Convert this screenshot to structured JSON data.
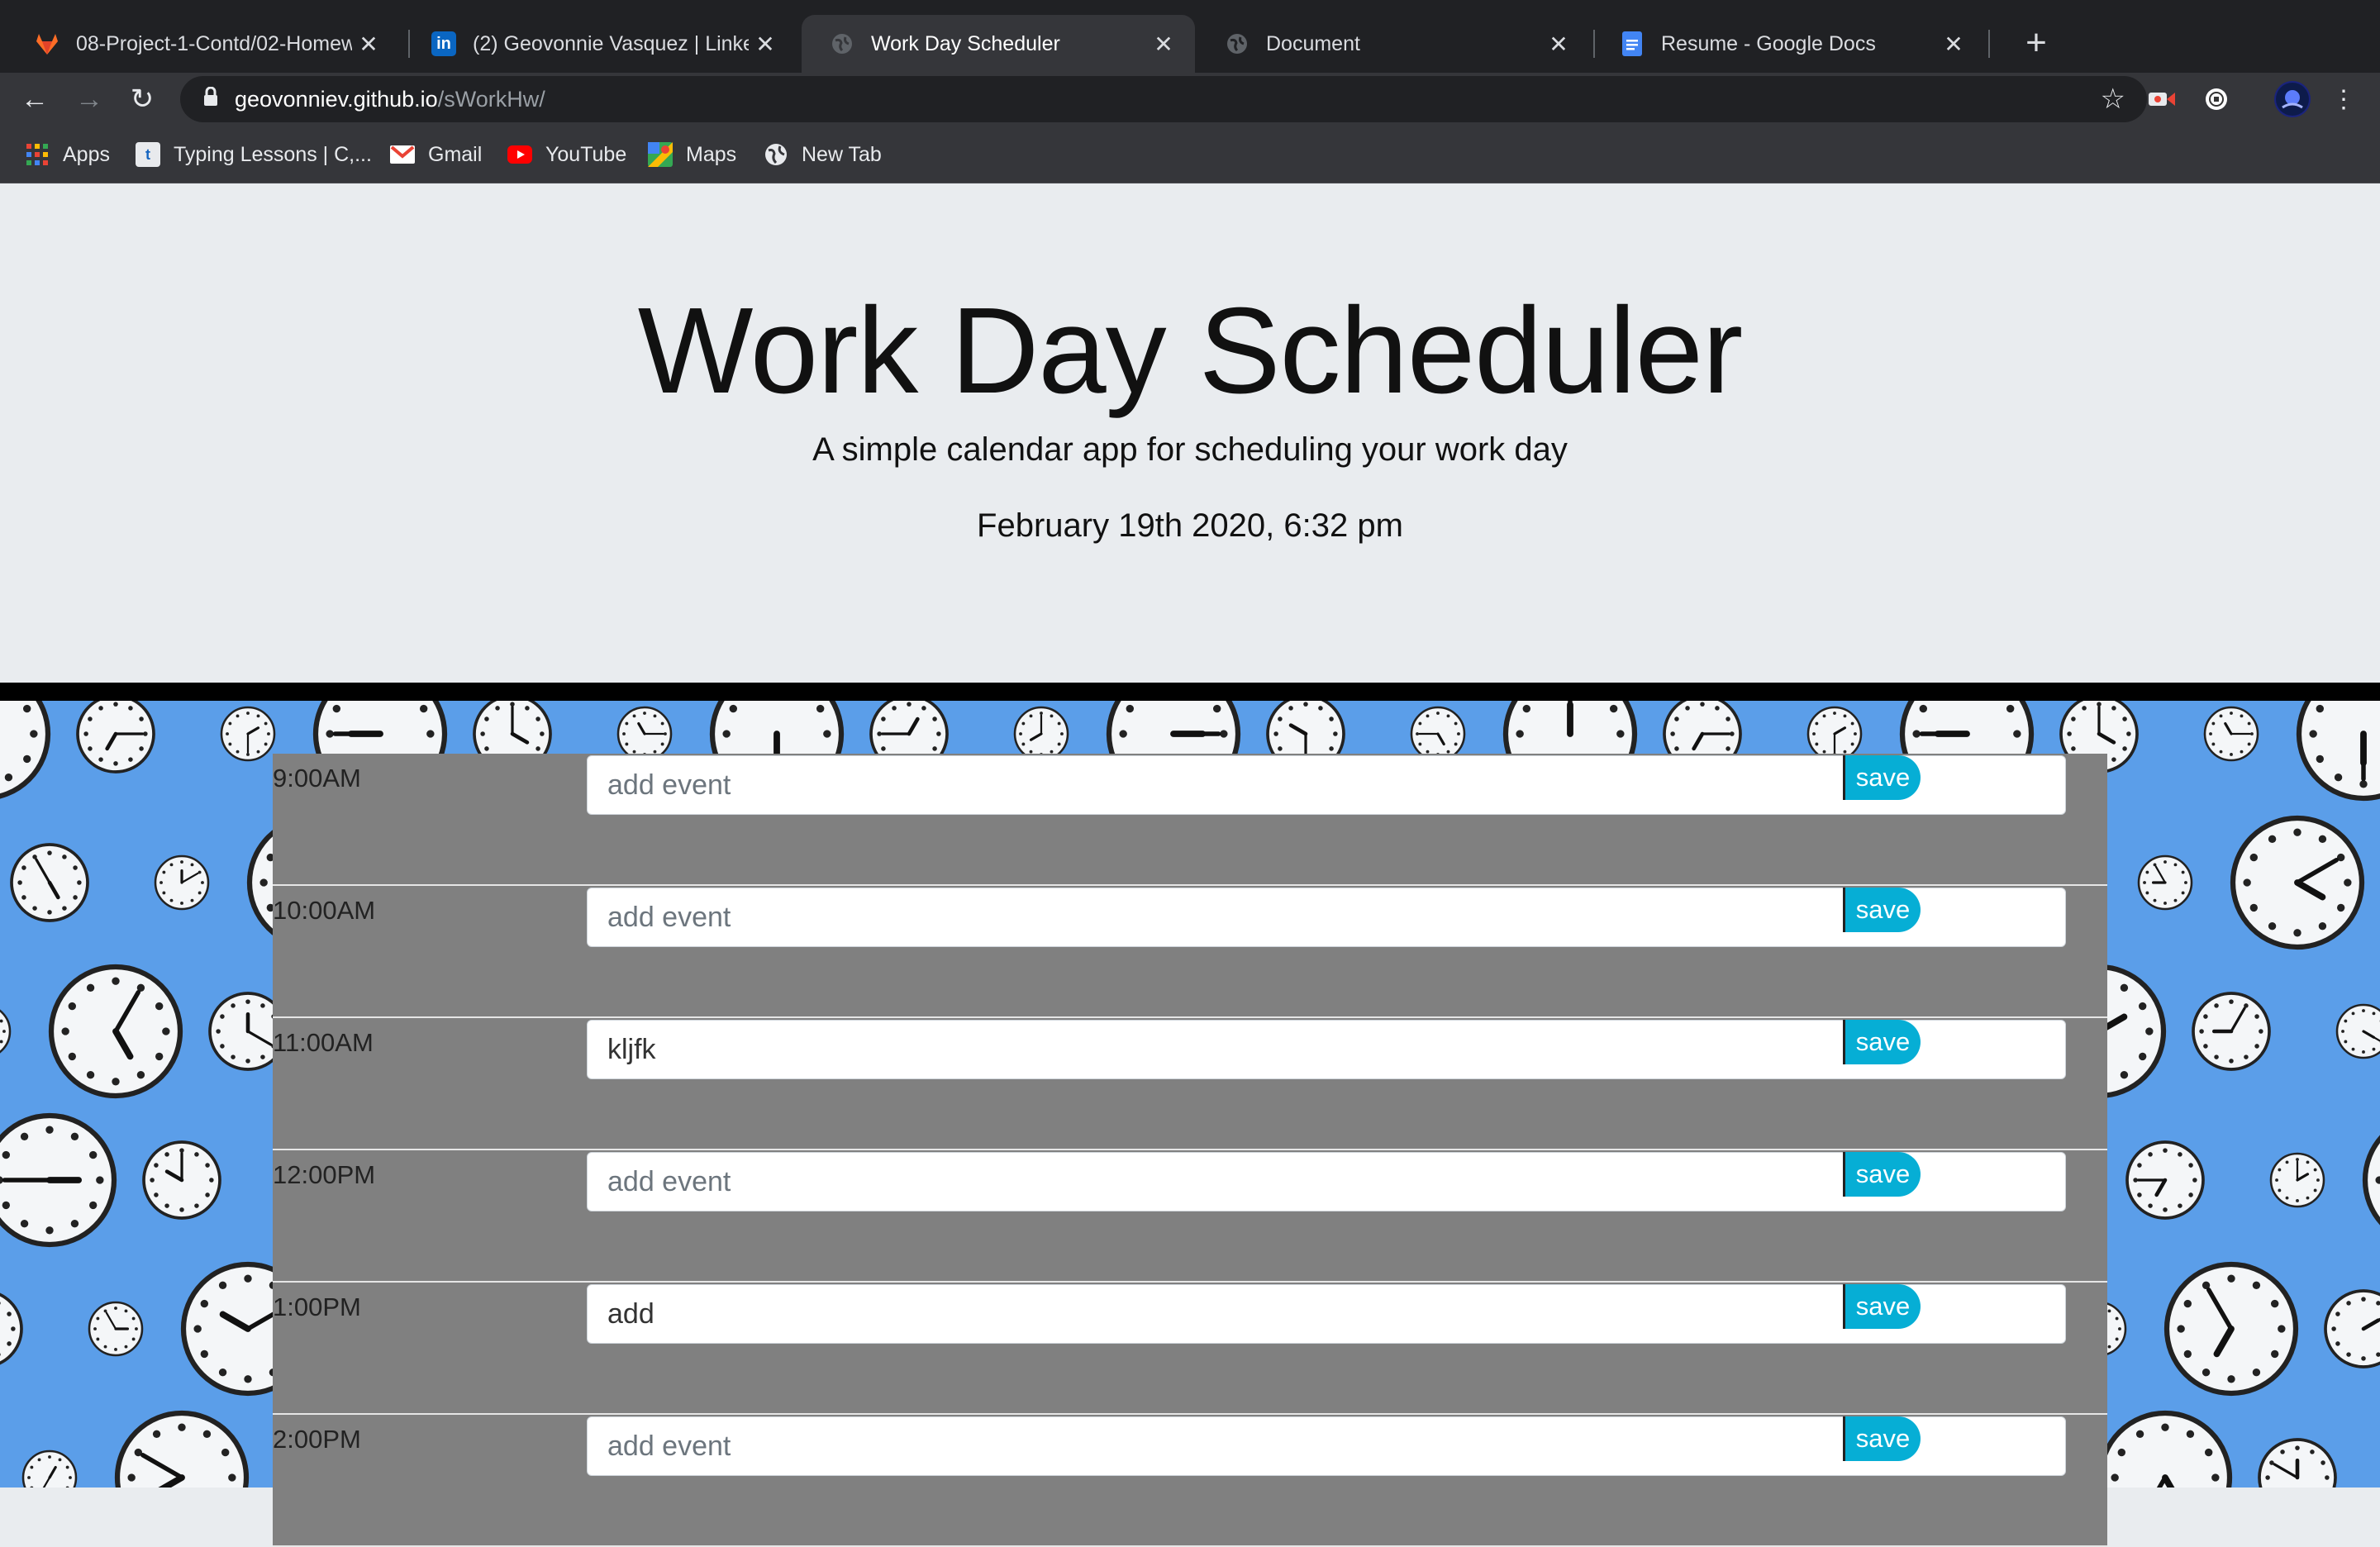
{
  "browser": {
    "tabs": [
      {
        "title": "08-Project-1-Contd/02-Homework",
        "icon": "gitlab-icon",
        "color": "#fc6d26",
        "active": false
      },
      {
        "title": "(2) Geovonnie Vasquez | LinkedIn",
        "icon": "linkedin-icon",
        "color": "#0a66c2",
        "active": false
      },
      {
        "title": "Work Day Scheduler",
        "icon": "globe-icon",
        "color": "#5f6368",
        "active": true
      },
      {
        "title": "Document",
        "icon": "globe-icon",
        "color": "#5f6368",
        "active": false
      },
      {
        "title": "Resume - Google Docs",
        "icon": "google-docs-icon",
        "color": "#4285f4",
        "active": false
      }
    ],
    "url_host": "geovonniev.github.io",
    "url_path": "/sWorkHw/",
    "bookmarks": [
      {
        "label": "Apps",
        "icon": "apps-grid-icon"
      },
      {
        "label": "Typing Lessons | C,...",
        "icon": "typing-icon"
      },
      {
        "label": "Gmail",
        "icon": "gmail-icon"
      },
      {
        "label": "YouTube",
        "icon": "youtube-icon"
      },
      {
        "label": "Maps",
        "icon": "maps-icon"
      },
      {
        "label": "New Tab",
        "icon": "globe-icon"
      }
    ]
  },
  "header": {
    "title": "Work Day Scheduler",
    "subtitle": "A simple calendar app for scheduling your work day",
    "current_day": "February 19th 2020, 6:32 pm"
  },
  "schedule": {
    "placeholder": "add event",
    "save_label": "save",
    "rows": [
      {
        "hour": "9:00AM",
        "value": ""
      },
      {
        "hour": "10:00AM",
        "value": ""
      },
      {
        "hour": "11:00AM",
        "value": "kljfk"
      },
      {
        "hour": "12:00PM",
        "value": ""
      },
      {
        "hour": "1:00PM",
        "value": "add"
      },
      {
        "hour": "2:00PM",
        "value": ""
      }
    ]
  },
  "colors": {
    "accent": "#06aed5",
    "row_bg": "#808080",
    "jumbotron_bg": "#e9ecef",
    "pattern_bg": "#5b9ee9"
  }
}
